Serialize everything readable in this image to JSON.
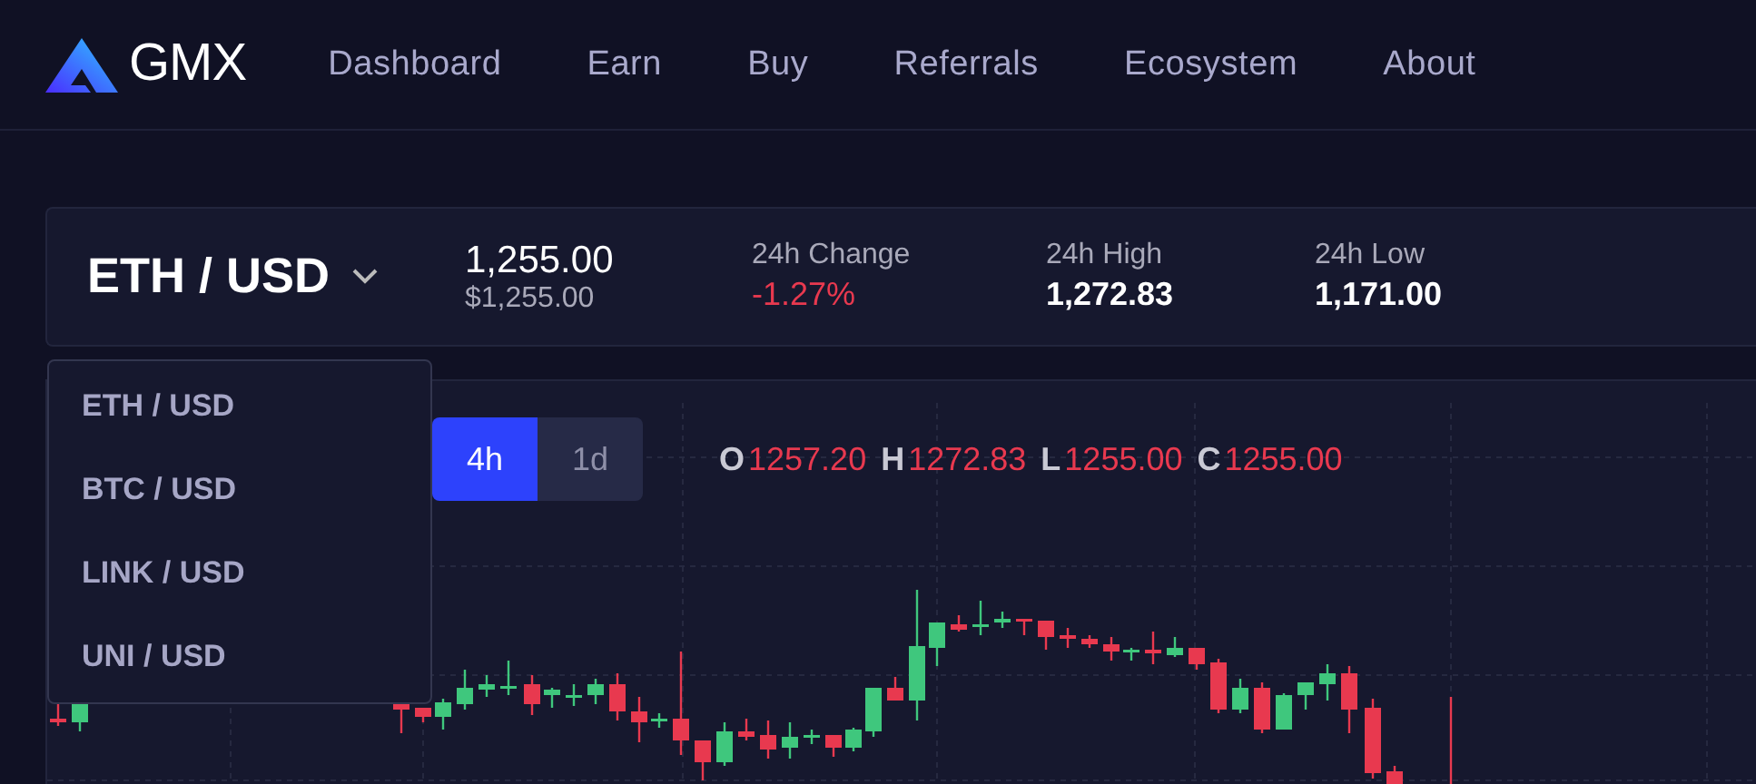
{
  "header": {
    "logo": "GMX",
    "nav": [
      {
        "label": "Dashboard"
      },
      {
        "label": "Earn"
      },
      {
        "label": "Buy"
      },
      {
        "label": "Referrals"
      },
      {
        "label": "Ecosystem"
      },
      {
        "label": "About"
      }
    ]
  },
  "ticker": {
    "pair": "ETH / USD",
    "price": "1,255.00",
    "price_usd": "$1,255.00",
    "stats": [
      {
        "label": "24h Change",
        "value": "-1.27%",
        "negative": true
      },
      {
        "label": "24h High",
        "value": "1,272.83",
        "negative": false
      },
      {
        "label": "24h Low",
        "value": "1,171.00",
        "negative": false
      }
    ]
  },
  "dropdown": {
    "expanded": true,
    "items": [
      {
        "label": "ETH / USD"
      },
      {
        "label": "BTC / USD"
      },
      {
        "label": "LINK / USD"
      },
      {
        "label": "UNI / USD"
      }
    ]
  },
  "chart": {
    "timeframes": [
      {
        "label": "4h",
        "selected": true
      },
      {
        "label": "1d",
        "selected": false
      }
    ],
    "ohlc": [
      {
        "key": "O",
        "value": "1257.20"
      },
      {
        "key": "H",
        "value": "1272.83"
      },
      {
        "key": "L",
        "value": "1255.00"
      },
      {
        "key": "C",
        "value": "1255.00"
      }
    ]
  }
}
